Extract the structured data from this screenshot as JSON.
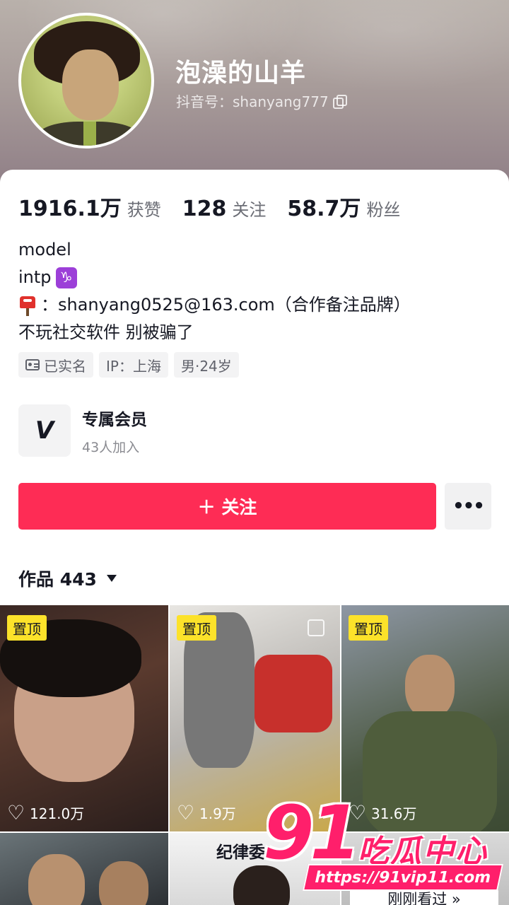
{
  "profile": {
    "nickname": "泡澡的山羊",
    "douyin_id": "抖音号：shanyang777"
  },
  "stats": [
    {
      "num": "1916.1万",
      "label": "获赞"
    },
    {
      "num": "128",
      "label": "关注"
    },
    {
      "num": "58.7万",
      "label": "粉丝"
    }
  ],
  "bio": {
    "line1": "model",
    "line2": "intp",
    "zodiac": "♑",
    "line3": "：shanyang0525@163.com（合作备注品牌）",
    "line4": "不玩社交软件 别被骗了"
  },
  "tags": {
    "verified": "已实名",
    "ip": "IP：上海",
    "gender_age": "男·24岁"
  },
  "member": {
    "icon": "V",
    "title": "专属会员",
    "sub": "43人加入"
  },
  "actions": {
    "follow": "＋ 关注",
    "more": "•••"
  },
  "works": {
    "label": "作品 443"
  },
  "videos": [
    {
      "pin": "置顶",
      "likes": "121.0万"
    },
    {
      "pin": "置顶",
      "likes": "1.9万"
    },
    {
      "pin": "置顶",
      "likes": "31.6万"
    }
  ],
  "second_row": {
    "tile2_text": "纪律委",
    "recent": "刚刚看过 »"
  },
  "watermark": {
    "num": "91",
    "cn": "吃瓜中心",
    "url": "https://91vip11.com"
  },
  "colors": {
    "follow": "#fe2c55",
    "pin": "#fce22a",
    "watermark": "#ff1f6b"
  }
}
